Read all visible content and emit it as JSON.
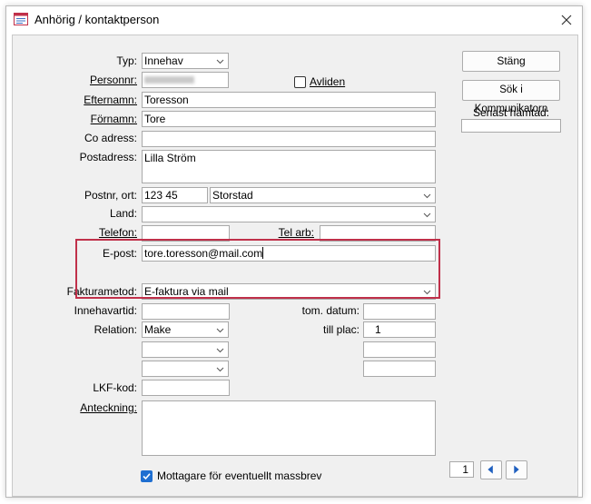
{
  "window": {
    "title": "Anhörig / kontaktperson",
    "icon": "form-icon",
    "close_icon": "close-icon"
  },
  "form": {
    "typ": {
      "label": "Typ:",
      "value": "Innehav"
    },
    "personnr": {
      "label": "Personnr:",
      "value": ""
    },
    "avliden": {
      "label": "Avliden",
      "checked": false
    },
    "efternamn": {
      "label": "Efternamn:",
      "value": "Toresson"
    },
    "fornamn": {
      "label": "Förnamn:",
      "value": "Tore"
    },
    "coadress": {
      "label": "Co adress:",
      "value": ""
    },
    "postadress": {
      "label": "Postadress:",
      "value": "Lilla Ström"
    },
    "postnr_ort": {
      "label": "Postnr, ort:",
      "postnr": "123 45",
      "ort": "Storstad"
    },
    "land": {
      "label": "Land:",
      "value": ""
    },
    "telefon": {
      "label": "Telefon:",
      "value": ""
    },
    "telarb": {
      "label": "Tel arb:",
      "value": ""
    },
    "epost": {
      "label": "E-post:",
      "value": "tore.toresson@mail.com"
    },
    "fakturametod": {
      "label": "Fakturametod:",
      "value": "E-faktura via mail"
    },
    "innehavartid": {
      "label": "Innehavartid:",
      "value": ""
    },
    "tomdatum": {
      "label": "tom. datum:",
      "value": ""
    },
    "relation": {
      "label": "Relation:",
      "value": "Make",
      "extra1": "",
      "extra2": ""
    },
    "tillplac": {
      "label": "till plac:",
      "value": "1",
      "extra1": "",
      "extra2": ""
    },
    "lkfkod": {
      "label": "LKF-kod:",
      "value": ""
    },
    "anteckning": {
      "label": "Anteckning:",
      "value": ""
    },
    "massbrev": {
      "label": "Mottagare för eventuellt massbrev",
      "checked": true
    }
  },
  "side": {
    "stang": "Stäng",
    "sok": "Sök i Kommunikatorn",
    "senast_label": "Senast hämtad:",
    "senast_value": ""
  },
  "nav": {
    "page": "1",
    "prev_icon": "triangle-left-icon",
    "next_icon": "triangle-right-icon"
  },
  "colors": {
    "highlight": "#c0304a",
    "accent": "#1f6fd1",
    "background": "#f0f0f0"
  }
}
